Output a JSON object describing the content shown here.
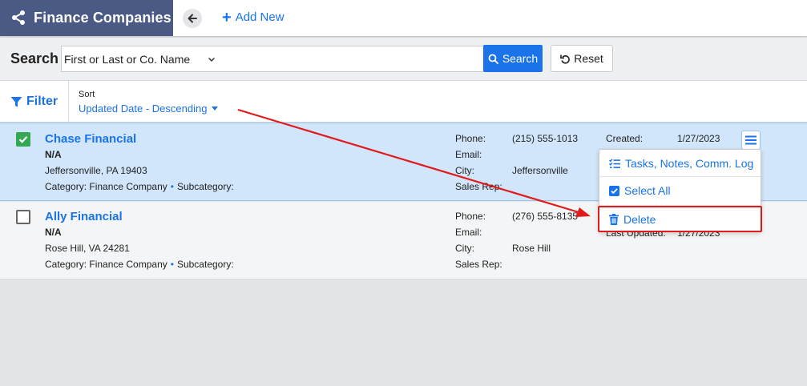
{
  "header": {
    "title": "Finance Companies",
    "add_new_label": "Add New"
  },
  "search": {
    "label": "Search",
    "field_selected": "First or Last or Co. Name",
    "query_value": "",
    "search_button_label": "Search",
    "reset_button_label": "Reset"
  },
  "filterbar": {
    "filter_label": "Filter",
    "sort_label": "Sort",
    "sort_value": "Updated Date - Descending"
  },
  "records": [
    {
      "name": "Chase Financial",
      "subtitle": "N/A",
      "address": "Jeffersonville, PA 19403",
      "category": "Category: Finance Company",
      "subcategory": "Subcategory:",
      "phone_label": "Phone:",
      "phone": "(215) 555-1013",
      "email_label": "Email:",
      "email": "",
      "city_label": "City:",
      "city": "Jeffersonville",
      "sales_rep_label": "Sales Rep:",
      "sales_rep": "",
      "created_label": "Created:",
      "created": "1/27/2023",
      "selected": true
    },
    {
      "name": "Ally Financial",
      "subtitle": "N/A",
      "address": "Rose Hill, VA 24281",
      "category": "Category: Finance Company",
      "subcategory": "Subcategory:",
      "phone_label": "Phone:",
      "phone": "(276) 555-8135",
      "email_label": "Email:",
      "email": "",
      "city_label": "City:",
      "city": "Rose Hill",
      "sales_rep_label": "Sales Rep:",
      "sales_rep": "",
      "last_updated_label": "Last Updated:",
      "last_updated": "1/27/2023",
      "selected": false
    }
  ],
  "menu": {
    "items": [
      {
        "label": "Tasks, Notes, Comm. Log",
        "icon": "list-check-icon"
      },
      {
        "label": "Select All",
        "icon": "checkbox-icon"
      },
      {
        "label": "Delete",
        "icon": "trash-icon"
      }
    ]
  },
  "colors": {
    "accent": "#1a73e8",
    "header_bg": "#4a5a85",
    "selected_row": "#d2e6fb",
    "annotation": "#e01b1b",
    "check_green": "#34a853"
  }
}
